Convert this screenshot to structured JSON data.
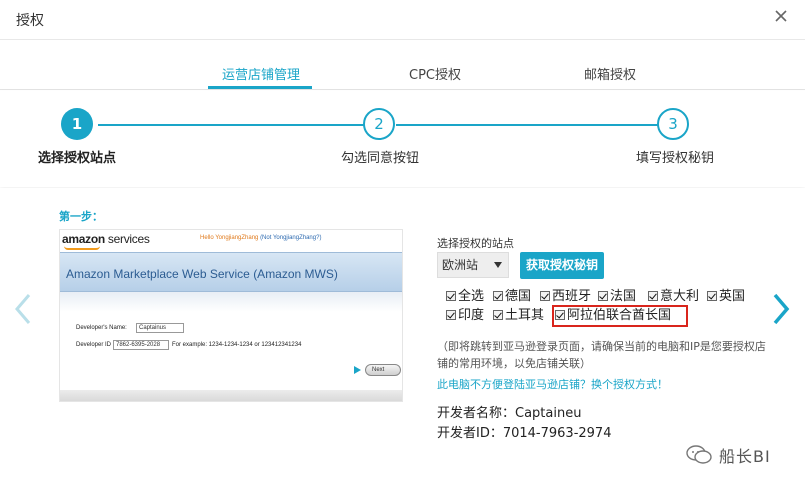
{
  "dialog": {
    "title": "授权"
  },
  "tabs": [
    {
      "label": "运营店铺管理",
      "active": true
    },
    {
      "label": "CPC授权",
      "active": false
    },
    {
      "label": "邮箱授权",
      "active": false
    }
  ],
  "steps": [
    {
      "number": "1",
      "label": "选择授权站点",
      "active": true
    },
    {
      "number": "2",
      "label": "勾选同意按钮",
      "active": false
    },
    {
      "number": "3",
      "label": "填写授权秘钥",
      "active": false
    }
  ],
  "instruction": {
    "step_label": "第一步：",
    "screenshot": {
      "logo_bold": "amazon",
      "logo_rest": " services",
      "hello_text": "Hello YongjiangZhang",
      "not_text": "(Not YongjiangZhang?)",
      "banner_title": "Amazon Marketplace Web Service  (Amazon MWS)",
      "dev_name_label": "Developer's Name",
      "dev_name_value": "Captainus",
      "dev_id_label": "Developer ID",
      "dev_id_value": "7862-6395-2028",
      "example_text": "For example: 1234-1234-1234 or 123412341234",
      "next_label": "Next"
    }
  },
  "site_selector": {
    "label": "选择授权的站点",
    "region_value": "欧洲站",
    "get_key_button": "获取授权秘钥"
  },
  "countries": [
    {
      "label": "全选",
      "checked": true
    },
    {
      "label": "德国",
      "checked": true
    },
    {
      "label": "西班牙",
      "checked": true
    },
    {
      "label": "法国",
      "checked": true
    },
    {
      "label": "意大利",
      "checked": true
    },
    {
      "label": "英国",
      "checked": true
    },
    {
      "label": "印度",
      "checked": true
    },
    {
      "label": "土耳其",
      "checked": true
    },
    {
      "label": "阿拉伯联合酋长国",
      "checked": true
    }
  ],
  "note": "（即将跳转到亚马逊登录页面，请确保当前的电脑和IP是您要授权店铺的常用环境，以免店铺关联）",
  "alt_link": "此电脑不方便登陆亚马逊店铺？换个授权方式！",
  "developer": {
    "name_line": "开发者名称：Captaineu",
    "id_line": "开发者ID：7014-7963-2974"
  },
  "watermark": {
    "text": "船长BI"
  },
  "colors": {
    "accent": "#1aa5c8",
    "highlight": "#d9251c"
  }
}
